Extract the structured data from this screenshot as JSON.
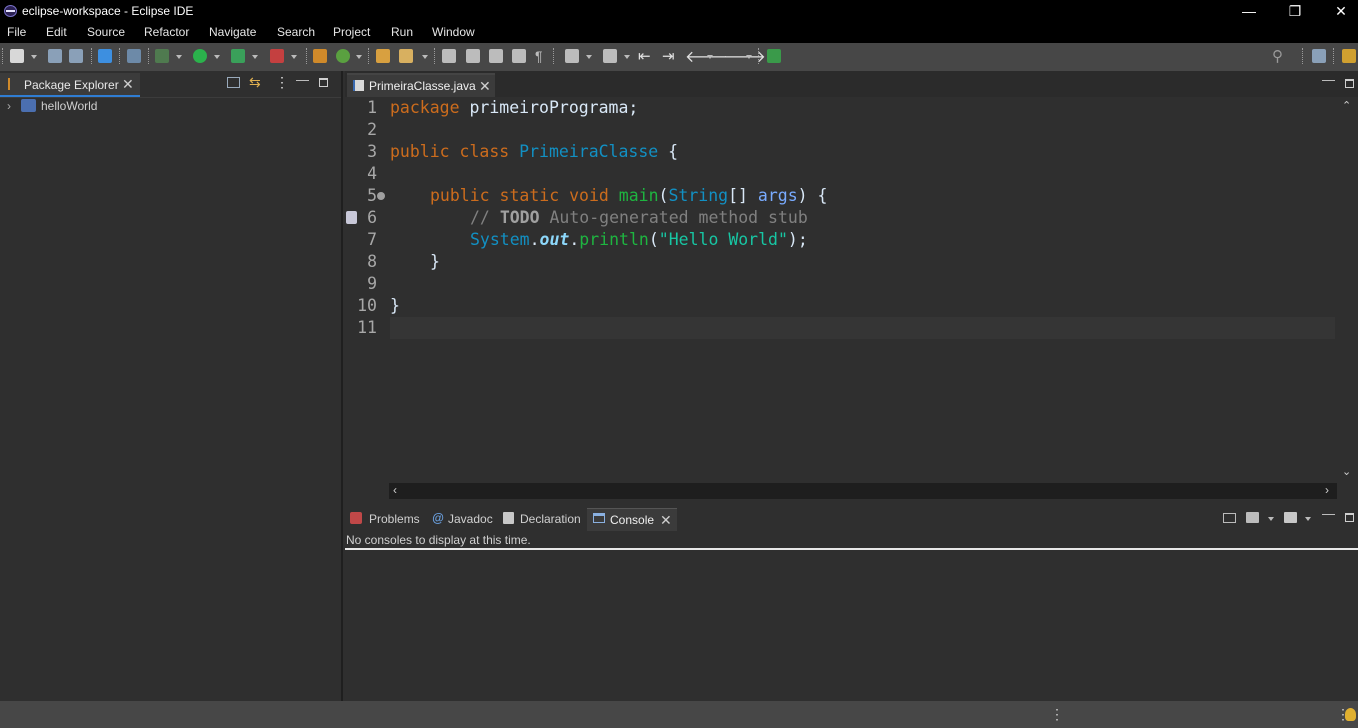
{
  "window": {
    "title": "eclipse-workspace - Eclipse IDE",
    "controls": [
      "—",
      "❐",
      "✕"
    ]
  },
  "menu": [
    "File",
    "Edit",
    "Source",
    "Refactor",
    "Navigate",
    "Search",
    "Project",
    "Run",
    "Window"
  ],
  "package_explorer": {
    "tab_label": "Package Explorer",
    "tree": [
      {
        "label": "helloWorld"
      }
    ]
  },
  "editor": {
    "tab_label": "PrimeiraClasse.java",
    "line_numbers": [
      "1",
      "2",
      "3",
      "4",
      "5",
      "6",
      "7",
      "8",
      "9",
      "10",
      "11"
    ],
    "code": {
      "l1_kw": "package",
      "l1_rest": " primeiroPrograma;",
      "l3_kw1": "public",
      "l3_kw2": "class",
      "l3_cls": "PrimeiraClasse",
      "l3_rest": " {",
      "l5_kw1": "public",
      "l5_kw2": "static",
      "l5_kw3": "void",
      "l5_mth": "main",
      "l5_p1": "(",
      "l5_cls": "String",
      "l5_p2": "[] ",
      "l5_var": "args",
      "l5_p3": ") {",
      "l6_cm1": "// ",
      "l6_todo": "TODO",
      "l6_cm2": " Auto-generated method stub",
      "l7_cls": "System",
      "l7_dot1": ".",
      "l7_field": "out",
      "l7_dot2": ".",
      "l7_mth": "println",
      "l7_p1": "(",
      "l7_str": "\"Hello World\"",
      "l7_p2": ");",
      "l8": "}",
      "l10": "}"
    }
  },
  "bottom_panel": {
    "tabs": [
      "Problems",
      "Javadoc",
      "Declaration",
      "Console"
    ],
    "active_tab": "Console",
    "console_message": "No consoles to display at this time."
  },
  "colors": {
    "keyword": "#cc6c1d",
    "class": "#1290c3",
    "method": "#1eb540",
    "string": "#17c6a3",
    "accent": "#2f7dd3"
  }
}
